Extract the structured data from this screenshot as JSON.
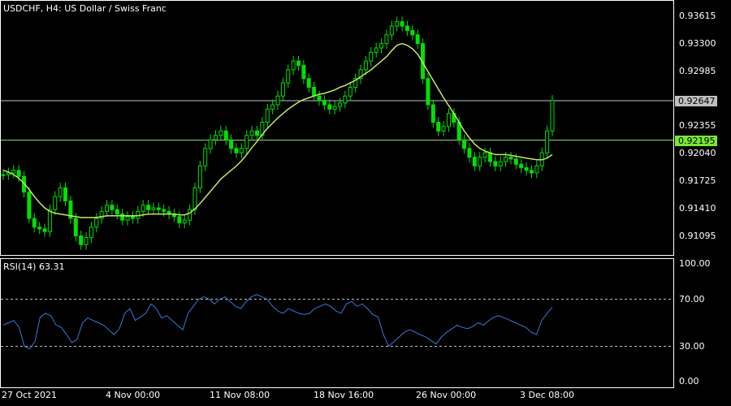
{
  "header": {
    "symbol": "USDCHF",
    "timeframe": "H4:",
    "description": "US Dollar / Swiss Franc",
    "title_text": "USDCHF, H4:  US Dollar / Swiss Franc"
  },
  "rsi_panel": {
    "title": "RSI(14) 63.31"
  },
  "colors": {
    "background": "#000000",
    "candle": "#00e100",
    "ma_line": "#c8e664",
    "rsi_line": "#3c78d8",
    "grid_line": "#ffffff",
    "bid_line": "#b4c8d2",
    "bid_tag_bg": "#c0c0c0",
    "mark_line": "#a0e070",
    "mark_tag_bg": "#78e632"
  },
  "price_axis": [
    "0.93615",
    "0.93300",
    "0.92985",
    "0.92647",
    "0.92355",
    "0.92195",
    "0.92040",
    "0.91725",
    "0.91410",
    "0.91095"
  ],
  "rsi_axis": [
    "100.00",
    "70.00",
    "30.00",
    "0.00"
  ],
  "time_axis": [
    "27 Oct 2021",
    "4 Nov 00:00",
    "11 Nov 08:00",
    "18 Nov 16:00",
    "26 Nov 00:00",
    "3 Dec 08:00"
  ],
  "tags": {
    "bid": "0.92647",
    "mark": "0.92195"
  },
  "chart_data": {
    "type": "line",
    "title": "USDCHF, H4:  US Dollar / Swiss Franc",
    "ylim": [
      0.909,
      0.9378
    ],
    "series": [
      {
        "name": "USDCHF",
        "values": [
          0.918,
          0.9182,
          0.9185,
          0.9178,
          0.916,
          0.913,
          0.912,
          0.9118,
          0.9115,
          0.914,
          0.9155,
          0.9165,
          0.915,
          0.913,
          0.911,
          0.91,
          0.9108,
          0.912,
          0.913,
          0.9138,
          0.9145,
          0.914,
          0.9135,
          0.9128,
          0.9132,
          0.913,
          0.9138,
          0.9145,
          0.914,
          0.9142,
          0.914,
          0.9138,
          0.9135,
          0.9132,
          0.9125,
          0.9128,
          0.914,
          0.9165,
          0.919,
          0.921,
          0.922,
          0.9225,
          0.923,
          0.922,
          0.921,
          0.9205,
          0.921,
          0.9225,
          0.923,
          0.9225,
          0.924,
          0.9255,
          0.926,
          0.927,
          0.9285,
          0.93,
          0.931,
          0.9305,
          0.929,
          0.928,
          0.927,
          0.9265,
          0.926,
          0.9255,
          0.9258,
          0.9262,
          0.927,
          0.928,
          0.929,
          0.93,
          0.931,
          0.932,
          0.9325,
          0.933,
          0.934,
          0.935,
          0.9355,
          0.935,
          0.9345,
          0.934,
          0.933,
          0.929,
          0.926,
          0.924,
          0.923,
          0.9235,
          0.925,
          0.924,
          0.922,
          0.921,
          0.92,
          0.919,
          0.92,
          0.9205,
          0.9195,
          0.919,
          0.9195,
          0.92,
          0.9198,
          0.9192,
          0.9188,
          0.9185,
          0.9182,
          0.919,
          0.9205,
          0.923,
          0.9265
        ]
      },
      {
        "name": "MA",
        "values": [
          0.9185,
          0.9183,
          0.918,
          0.9176,
          0.917,
          0.9163,
          0.9155,
          0.9148,
          0.9142,
          0.9138,
          0.9136,
          0.9135,
          0.9134,
          0.9133,
          0.9132,
          0.9131,
          0.9131,
          0.9131,
          0.9131,
          0.9132,
          0.9133,
          0.9133,
          0.9133,
          0.9133,
          0.9133,
          0.9133,
          0.9133,
          0.9134,
          0.9135,
          0.9135,
          0.9135,
          0.9135,
          0.9135,
          0.9135,
          0.9134,
          0.9134,
          0.9136,
          0.9141,
          0.9147,
          0.9154,
          0.9161,
          0.9168,
          0.9175,
          0.918,
          0.9185,
          0.919,
          0.9196,
          0.9203,
          0.9211,
          0.9218,
          0.9226,
          0.9233,
          0.9239,
          0.9245,
          0.925,
          0.9255,
          0.9259,
          0.9263,
          0.9266,
          0.9268,
          0.927,
          0.9272,
          0.9273,
          0.9275,
          0.9277,
          0.928,
          0.9282,
          0.9285,
          0.9288,
          0.9292,
          0.9296,
          0.93,
          0.9305,
          0.931,
          0.9315,
          0.9322,
          0.9328,
          0.933,
          0.9328,
          0.9324,
          0.9318,
          0.9308,
          0.9298,
          0.9288,
          0.9278,
          0.9268,
          0.9259,
          0.925,
          0.924,
          0.923,
          0.9222,
          0.9215,
          0.921,
          0.9207,
          0.9205,
          0.9203,
          0.9203,
          0.9203,
          0.9202,
          0.9201,
          0.92,
          0.9199,
          0.9198,
          0.9197,
          0.9197,
          0.9199,
          0.9203
        ]
      }
    ],
    "rsi": {
      "name": "RSI(14)",
      "ylim": [
        0,
        100
      ],
      "values": [
        48,
        50,
        52,
        46,
        30,
        28,
        34,
        55,
        58,
        56,
        48,
        46,
        40,
        33,
        36,
        50,
        54,
        52,
        50,
        48,
        44,
        40,
        45,
        58,
        62,
        52,
        55,
        58,
        66,
        62,
        54,
        56,
        52,
        48,
        44,
        58,
        64,
        70,
        72,
        70,
        66,
        70,
        72,
        68,
        64,
        62,
        68,
        72,
        74,
        72,
        70,
        64,
        60,
        58,
        62,
        60,
        58,
        57,
        58,
        62,
        64,
        66,
        64,
        60,
        58,
        66,
        68,
        64,
        66,
        62,
        57,
        55,
        40,
        30,
        34,
        38,
        42,
        44,
        42,
        40,
        38,
        35,
        32,
        38,
        42,
        45,
        48,
        46,
        45,
        47,
        50,
        48,
        52,
        55,
        56,
        54,
        52,
        50,
        48,
        46,
        42,
        40,
        52,
        58,
        63
      ]
    }
  }
}
